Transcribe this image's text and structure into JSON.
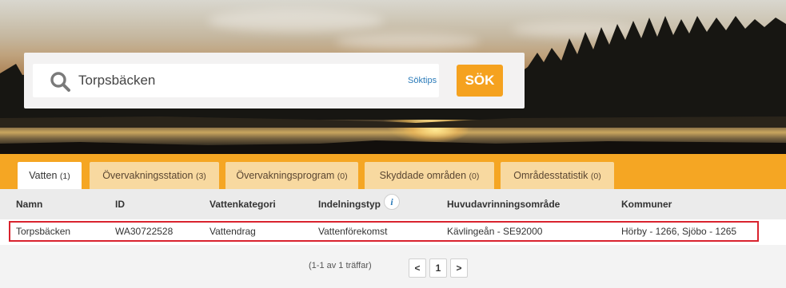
{
  "search": {
    "value": "Torpsbäcken",
    "tips_label": "Söktips",
    "button_label": "SÖK"
  },
  "tabs": [
    {
      "label": "Vatten",
      "count": "(1)",
      "active": true
    },
    {
      "label": "Övervakningsstation",
      "count": "(3)",
      "active": false
    },
    {
      "label": "Övervakningsprogram",
      "count": "(0)",
      "active": false
    },
    {
      "label": "Skyddade områden",
      "count": "(0)",
      "active": false
    },
    {
      "label": "Områdesstatistik",
      "count": "(0)",
      "active": false
    }
  ],
  "table": {
    "columns": [
      "Namn",
      "ID",
      "Vattenkategori",
      "Indelningstyp",
      "Huvudavrinningsområde",
      "Kommuner"
    ],
    "info_icon": "i",
    "rows": [
      [
        "Torpsbäcken",
        "WA30722528",
        "Vattendrag",
        "Vattenförekomst",
        "Kävlingeån - SE92000",
        "Hörby - 1266, Sjöbo - 1265"
      ]
    ]
  },
  "pager": {
    "summary": "(1-1 av 1 träffar)",
    "prev_label": "<",
    "page_label": "1",
    "next_label": ">"
  },
  "colors": {
    "accent": "#f5a623",
    "button": "#f5a21f",
    "highlight_border": "#d9232e",
    "link": "#2b7bb9"
  }
}
